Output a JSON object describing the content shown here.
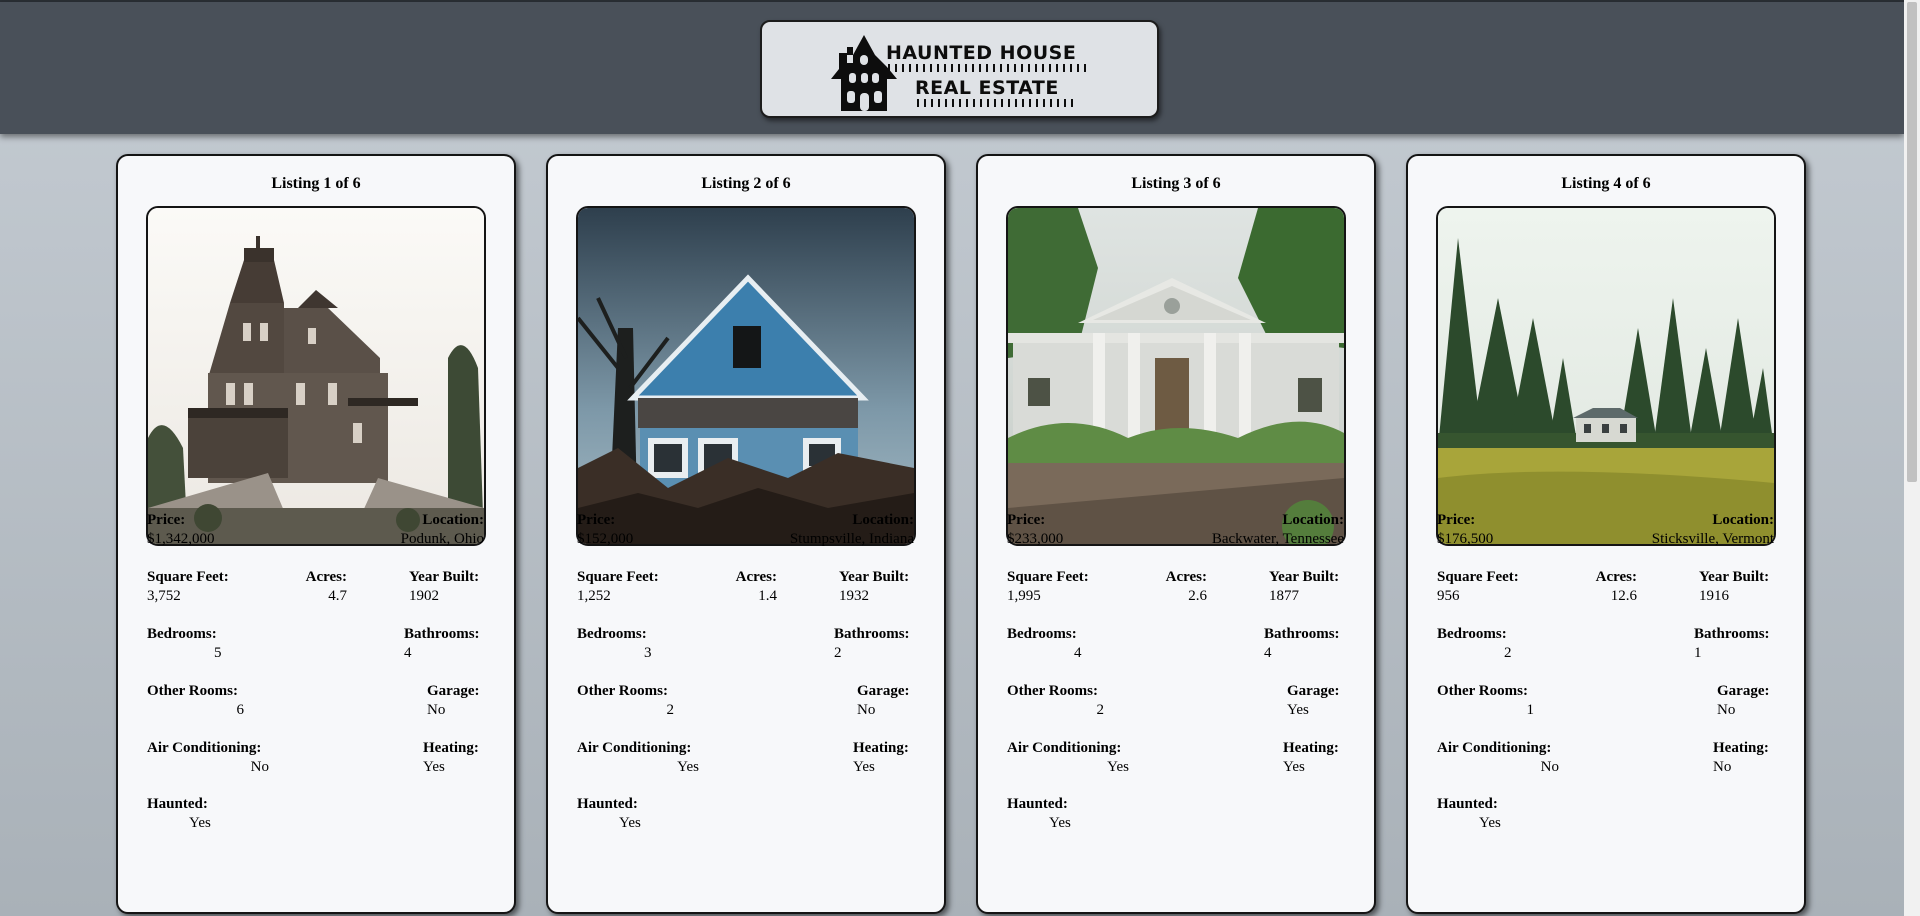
{
  "brand": {
    "line1": "HAUNTED HOUSE",
    "line2": "REAL ESTATE"
  },
  "labels": {
    "price": "Price:",
    "location": "Location:",
    "sqft": "Square Feet:",
    "acres": "Acres:",
    "year": "Year Built:",
    "bedrooms": "Bedrooms:",
    "bathrooms": "Bathrooms:",
    "other_rooms": "Other Rooms:",
    "garage": "Garage:",
    "ac": "Air Conditioning:",
    "heating": "Heating:",
    "haunted": "Haunted:"
  },
  "listings": [
    {
      "title": "Listing 1 of 6",
      "photo_icon": "victorian-mansion-photo",
      "price": "$1,342,000",
      "location": "Podunk, Ohio",
      "sqft": "3,752",
      "acres": "4.7",
      "year": "1902",
      "bedrooms": "5",
      "bathrooms": "4",
      "other_rooms": "6",
      "garage": "No",
      "ac": "No",
      "heating": "Yes",
      "haunted": "Yes"
    },
    {
      "title": "Listing 2 of 6",
      "photo_icon": "blue-house-photo",
      "price": "$152,000",
      "location": "Stumpsville, Indiana",
      "sqft": "1,252",
      "acres": "1.4",
      "year": "1932",
      "bedrooms": "3",
      "bathrooms": "2",
      "other_rooms": "2",
      "garage": "No",
      "ac": "Yes",
      "heating": "Yes",
      "haunted": "Yes"
    },
    {
      "title": "Listing 3 of 6",
      "photo_icon": "white-columns-house-photo",
      "price": "$233,000",
      "location": "Backwater, Tennessee",
      "sqft": "1,995",
      "acres": "2.6",
      "year": "1877",
      "bedrooms": "4",
      "bathrooms": "4",
      "other_rooms": "2",
      "garage": "Yes",
      "ac": "Yes",
      "heating": "Yes",
      "haunted": "Yes"
    },
    {
      "title": "Listing 4 of 6",
      "photo_icon": "cottage-in-forest-photo",
      "price": "$176,500",
      "location": "Sticksville, Vermont",
      "sqft": "956",
      "acres": "12.6",
      "year": "1916",
      "bedrooms": "2",
      "bathrooms": "1",
      "other_rooms": "1",
      "garage": "No",
      "ac": "No",
      "heating": "No",
      "haunted": "Yes"
    }
  ]
}
